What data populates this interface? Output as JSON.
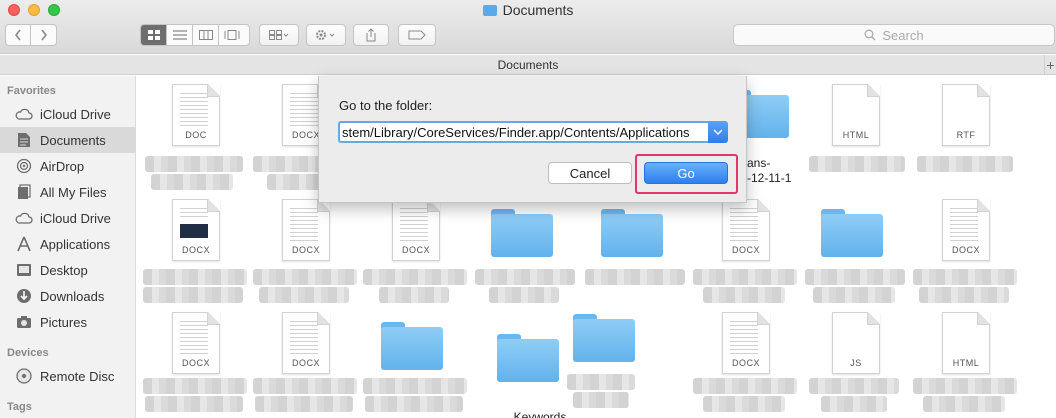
{
  "window": {
    "title": "Documents"
  },
  "toolbar": {
    "search_placeholder": "Search",
    "path_title": "Documents"
  },
  "sidebar": {
    "favorites_header": "Favorites",
    "favorites": [
      {
        "label": "iCloud Drive",
        "icon": "cloud-icon"
      },
      {
        "label": "Documents",
        "icon": "document-icon",
        "selected": true
      },
      {
        "label": "AirDrop",
        "icon": "airdrop-icon"
      },
      {
        "label": "All My Files",
        "icon": "files-icon"
      },
      {
        "label": "iCloud Drive",
        "icon": "cloud-icon"
      },
      {
        "label": "Applications",
        "icon": "applications-icon"
      },
      {
        "label": "Desktop",
        "icon": "desktop-icon"
      },
      {
        "label": "Downloads",
        "icon": "download-icon"
      },
      {
        "label": "Pictures",
        "icon": "camera-icon"
      }
    ],
    "devices_header": "Devices",
    "devices": [
      {
        "label": "Remote Disc",
        "icon": "disc-icon"
      }
    ],
    "tags_header": "Tags"
  },
  "files": {
    "row1": [
      {
        "kind": "doc",
        "label": "DOC"
      },
      {
        "kind": "doc",
        "label": "DOCX"
      },
      {
        "kind": "doc",
        "label": ""
      },
      {
        "kind": "doc",
        "label": ""
      },
      {
        "kind": "folder",
        "label": "",
        "caption": "ans-\n-12-11-1"
      },
      {
        "kind": "doc",
        "label": ""
      },
      {
        "kind": "doc-plain",
        "label": "HTML"
      },
      {
        "kind": "doc-plain",
        "label": "RTF"
      }
    ],
    "row2": [
      {
        "kind": "doc-pic",
        "label": "DOCX"
      },
      {
        "kind": "doc",
        "label": "DOCX"
      },
      {
        "kind": "doc",
        "label": "DOCX"
      },
      {
        "kind": "folder"
      },
      {
        "kind": "folder"
      },
      {
        "kind": "doc",
        "label": "DOCX"
      },
      {
        "kind": "folder"
      },
      {
        "kind": "doc",
        "label": "DOCX"
      }
    ],
    "row3": [
      {
        "kind": "doc",
        "label": "DOCX"
      },
      {
        "kind": "doc",
        "label": "DOCX"
      },
      {
        "kind": "folder"
      },
      {
        "kind": "folder",
        "caption": "Keywords"
      },
      {
        "kind": "folder"
      },
      {
        "kind": "doc",
        "label": "DOCX"
      },
      {
        "kind": "doc-plain",
        "label": "JS"
      },
      {
        "kind": "doc-plain",
        "label": "HTML"
      }
    ]
  },
  "goto_dialog": {
    "prompt": "Go to the folder:",
    "path_value": "stem/Library/CoreServices/Finder.app/Contents/Applications",
    "cancel_label": "Cancel",
    "go_label": "Go",
    "highlight_color": "#e8336b"
  }
}
